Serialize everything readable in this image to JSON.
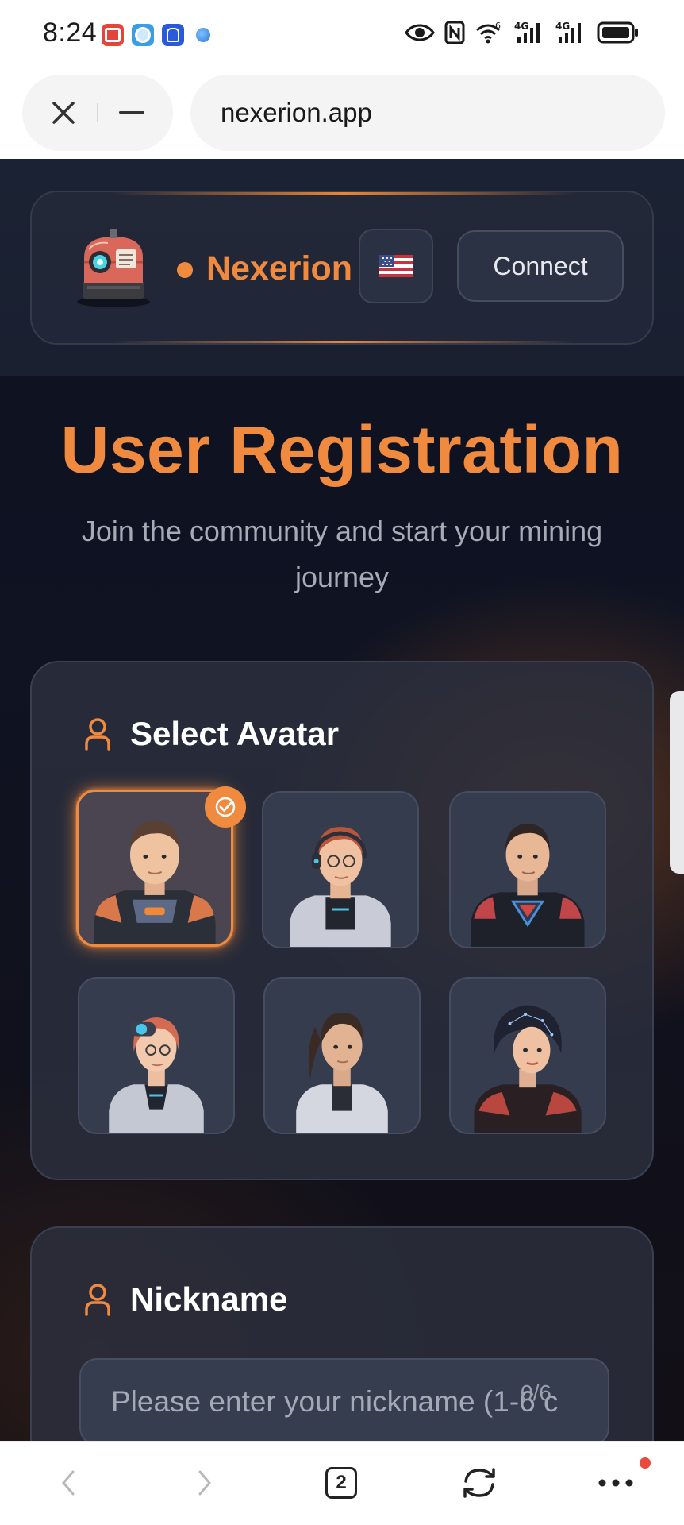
{
  "status_bar": {
    "time": "8:24",
    "app_icons": [
      "red-app-icon",
      "light-blue-app-icon",
      "blue-app-icon",
      "globe-app-icon"
    ],
    "right_icons": [
      "eye-icon",
      "nfc-icon",
      "wifi-icon",
      "signal-4g-icon",
      "signal-4g-icon",
      "battery-icon"
    ],
    "wifi_label": "6",
    "network_label": "4G"
  },
  "browser": {
    "url": "nexerion.app",
    "close_icon": "close-icon",
    "minimize_icon": "minimize-icon"
  },
  "header": {
    "brand_name": "Nexerion",
    "language_flag": "us-flag-icon",
    "connect_label": "Connect"
  },
  "hero": {
    "title": "User Registration",
    "subtitle": "Join the community and start your mining journey"
  },
  "avatar_section": {
    "title": "Select Avatar",
    "selected_index": 0,
    "avatars": [
      {
        "name": "avatar-male-soldier"
      },
      {
        "name": "avatar-male-headset"
      },
      {
        "name": "avatar-male-dark-armor"
      },
      {
        "name": "avatar-female-goggles"
      },
      {
        "name": "avatar-female-ponytail"
      },
      {
        "name": "avatar-female-hooded"
      }
    ]
  },
  "nickname_section": {
    "title": "Nickname",
    "placeholder": "Please enter your nickname (1-6 c",
    "counter": "0/6"
  },
  "bottom_nav": {
    "tab_count": "2",
    "icons": [
      "back-icon",
      "forward-icon",
      "tabs-icon",
      "refresh-icon",
      "more-icon"
    ]
  },
  "colors": {
    "accent": "#ef8a3f",
    "page_bg": "#0f1322",
    "card_bg": "#2c303e",
    "notification": "#e64b3c"
  }
}
